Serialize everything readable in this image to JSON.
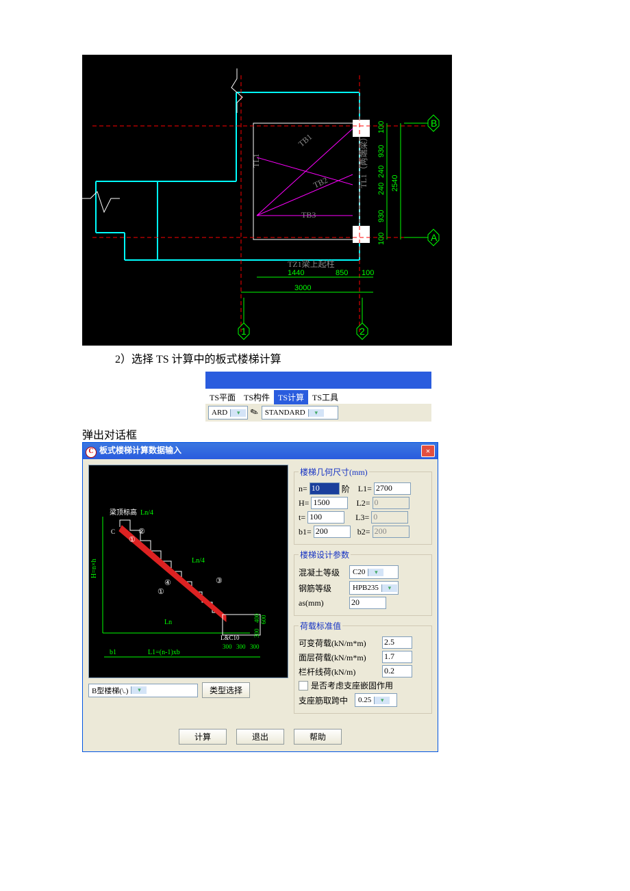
{
  "cad": {
    "labels": {
      "tl1": "TL1",
      "tb1": "TB1",
      "tb2": "TB2",
      "tb3": "TB3",
      "tl1b": "TL1（两端梁）",
      "tz1": "TZ1梁上起柱"
    },
    "dims": {
      "d1440": "1440",
      "d850": "850",
      "d100a": "100",
      "d3000": "3000",
      "d100t": "100",
      "d930a": "930",
      "d240": "240",
      "d240b": "240",
      "d930b": "930",
      "d100b": "100",
      "d2540": "2540"
    },
    "grid": {
      "g1": "1",
      "g2": "2",
      "gA": "A",
      "gB": "B"
    }
  },
  "step2_text": "2）选择 TS 计算中的板式楼梯计算",
  "toolbar": {
    "tabs": {
      "plane": "TS平面",
      "comp": "TS构件",
      "calc": "TS计算",
      "tool": "TS工具"
    },
    "style1": "ARD",
    "style2": "STANDARD"
  },
  "popup_text": "弹出对话框",
  "dialog": {
    "title": "板式楼梯计算数据输入",
    "left_dropdown": "B型楼梯(\\.)",
    "type_select": "类型选择",
    "preview": {
      "top_label": "梁顶标高",
      "Ln4a": "Ln/4",
      "Ln4b": "Ln/4",
      "c_label": "C",
      "n1": "①",
      "n2": "②",
      "n3": "③",
      "n4": "④",
      "Hnxh": "H=n×h",
      "Ln": "Ln",
      "b1": "b1",
      "L1eq": "L1=(n-1)xb",
      "sc10": "L&C10",
      "d300a": "300",
      "d300b": "300",
      "d300c": "300",
      "d300d": "300",
      "d400": "400",
      "d600": "600"
    },
    "geom_section": "楼梯几何尺寸(mm)",
    "geom": {
      "n_lbl": "n=",
      "n_val": "10",
      "jie": "阶",
      "L1_lbl": "L1=",
      "L1_val": "2700",
      "H_lbl": "H=",
      "H_val": "1500",
      "L2_lbl": "L2=",
      "L2_val": "0",
      "t_lbl": "t=",
      "t_val": "100",
      "L3_lbl": "L3=",
      "L3_val": "0",
      "b1_lbl": "b1=",
      "b1_val": "200",
      "b2_lbl": "b2=",
      "b2_val": "200"
    },
    "design_section": "楼梯设计参数",
    "design": {
      "concrete_lbl": "混凝土等级",
      "concrete_val": "C20",
      "rebar_lbl": "钢筋等级",
      "rebar_val": "HPB235",
      "as_lbl": "as(mm)",
      "as_val": "20"
    },
    "load_section": "荷载标准值",
    "load": {
      "live_lbl": "可变荷载(kN/m*m)",
      "live_val": "2.5",
      "surf_lbl": "面层荷载(kN/m*m)",
      "surf_val": "1.7",
      "rail_lbl": "栏杆线荷(kN/m)",
      "rail_val": "0.2",
      "fixed_chk": "是否考虑支座嵌固作用",
      "mid_lbl": "支座筋取跨中",
      "mid_val": "0.25"
    },
    "btns": {
      "calc": "计算",
      "exit": "退出",
      "help": "帮助"
    }
  }
}
